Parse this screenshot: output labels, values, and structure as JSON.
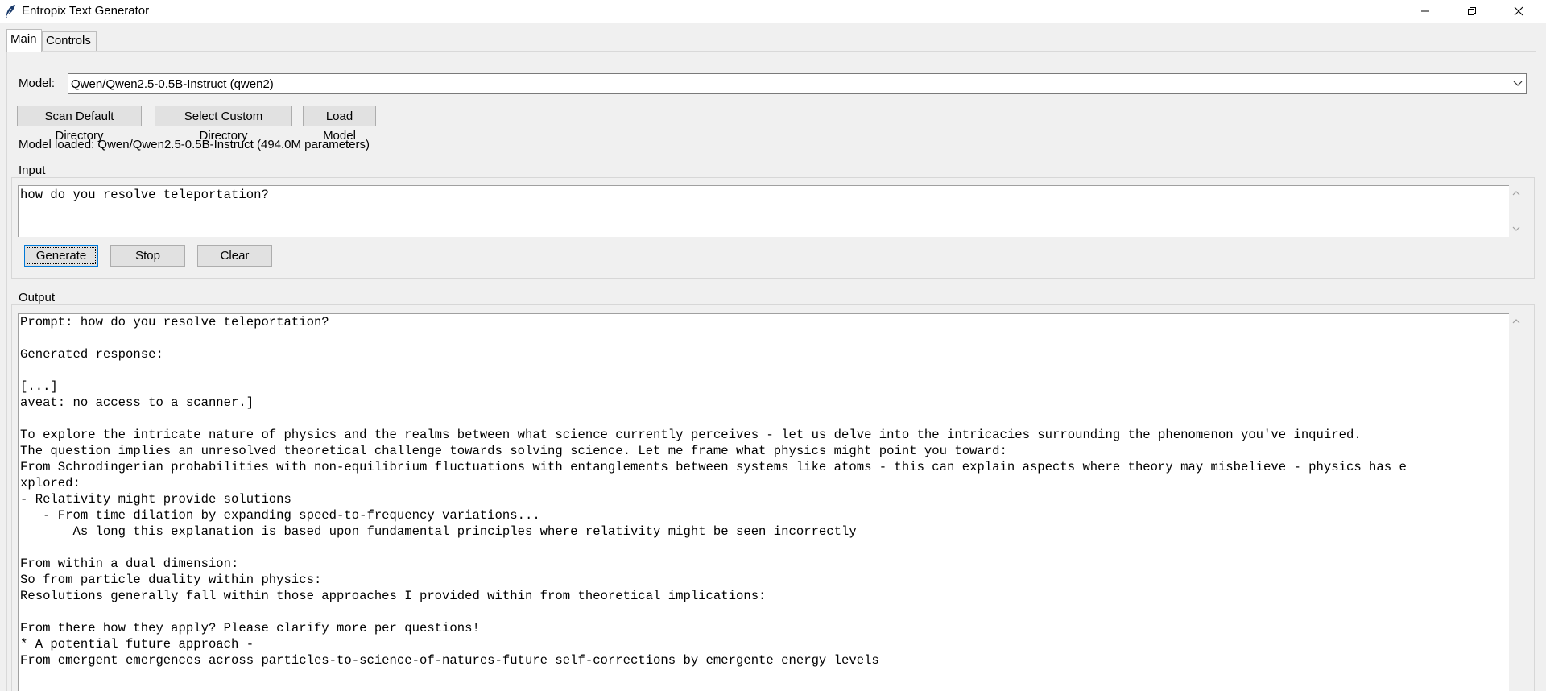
{
  "window": {
    "title": "Entropix Text Generator"
  },
  "tabs": [
    {
      "label": "Main",
      "active": true
    },
    {
      "label": "Controls",
      "active": false
    }
  ],
  "model": {
    "label": "Model:",
    "selected": "Qwen/Qwen2.5-0.5B-Instruct (qwen2)"
  },
  "buttons": {
    "scan_default": "Scan Default Directory",
    "select_custom": "Select Custom Directory",
    "load_model": "Load Model",
    "generate": "Generate",
    "stop": "Stop",
    "clear": "Clear"
  },
  "status": "Model loaded: Qwen/Qwen2.5-0.5B-Instruct (494.0M parameters)",
  "input": {
    "label": "Input",
    "value": "how do you resolve teleportation?"
  },
  "output": {
    "label": "Output",
    "lines": [
      "Prompt: how do you resolve teleportation?",
      "",
      "Generated response:",
      "",
      "[...]",
      "aveat: no access to a scanner.]",
      "",
      "To explore the intricate nature of physics and the realms between what science currently perceives - let us delve into the intricacies surrounding the phenomenon you've inquired.",
      "The question implies an unresolved theoretical challenge towards solving science. Let me frame what physics might point you toward:",
      "From Schrodingerian probabilities with non-equilibrium fluctuations with entanglements between systems like atoms - this can explain aspects where theory may misbelieve - physics has e",
      "xplored:",
      "- Relativity might provide solutions",
      "   - From time dilation by expanding speed-to-frequency variations...",
      "       As long this explanation is based upon fundamental principles where relativity might be seen incorrectly",
      "",
      "From within a dual dimension:",
      "So from particle duality within physics:",
      "Resolutions generally fall within those approaches I provided within from theoretical implications:",
      "",
      "From there how they apply? Please clarify more per questions!",
      "* A potential future approach -",
      "From emergent emergences across particles-to-science-of-natures-future self-corrections by emergente energy levels"
    ]
  }
}
